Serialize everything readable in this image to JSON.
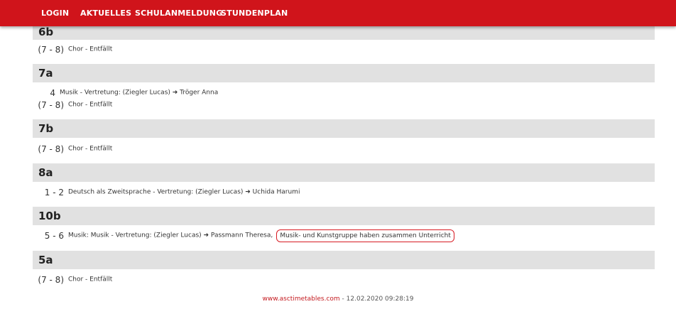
{
  "nav": {
    "items": [
      "LOGIN",
      "AKTUELLES",
      "SCHULANMELDUNG",
      "STUNDENPLAN"
    ]
  },
  "classes": [
    {
      "name": "6b",
      "entries": [
        {
          "period": "(7 - 8)",
          "text": "Chor - Entfällt"
        }
      ]
    },
    {
      "name": "7a",
      "entries": [
        {
          "period": "4",
          "text": "Musik - Vertretung: (Ziegler Lucas) ➜ Tröger Anna"
        },
        {
          "period": "(7 - 8)",
          "text": "Chor - Entfällt"
        }
      ]
    },
    {
      "name": "7b",
      "entries": [
        {
          "period": "(7 - 8)",
          "text": "Chor - Entfällt"
        }
      ]
    },
    {
      "name": "8a",
      "entries": [
        {
          "period": "1 - 2",
          "text": "Deutsch als Zweitsprache - Vertretung: (Ziegler Lucas) ➜ Uchida Harumi"
        }
      ]
    },
    {
      "name": "10b",
      "entries": [
        {
          "period": "5 - 6",
          "text": "Musik: Musik - Vertretung: (Ziegler Lucas) ➜ Passmann Theresa,",
          "note": "Musik- und Kunstgruppe haben zusammen Unterricht"
        }
      ]
    },
    {
      "name": "5a",
      "entries": [
        {
          "period": "(7 - 8)",
          "text": "Chor - Entfällt"
        }
      ]
    }
  ],
  "footer": {
    "link": "www.asctimetables.com",
    "text": " - 12.02.2020 09:28:19"
  },
  "colors": {
    "navbar": "#d0141b",
    "header_bg": "#e1e1e1",
    "highlight": "#d81b23"
  }
}
